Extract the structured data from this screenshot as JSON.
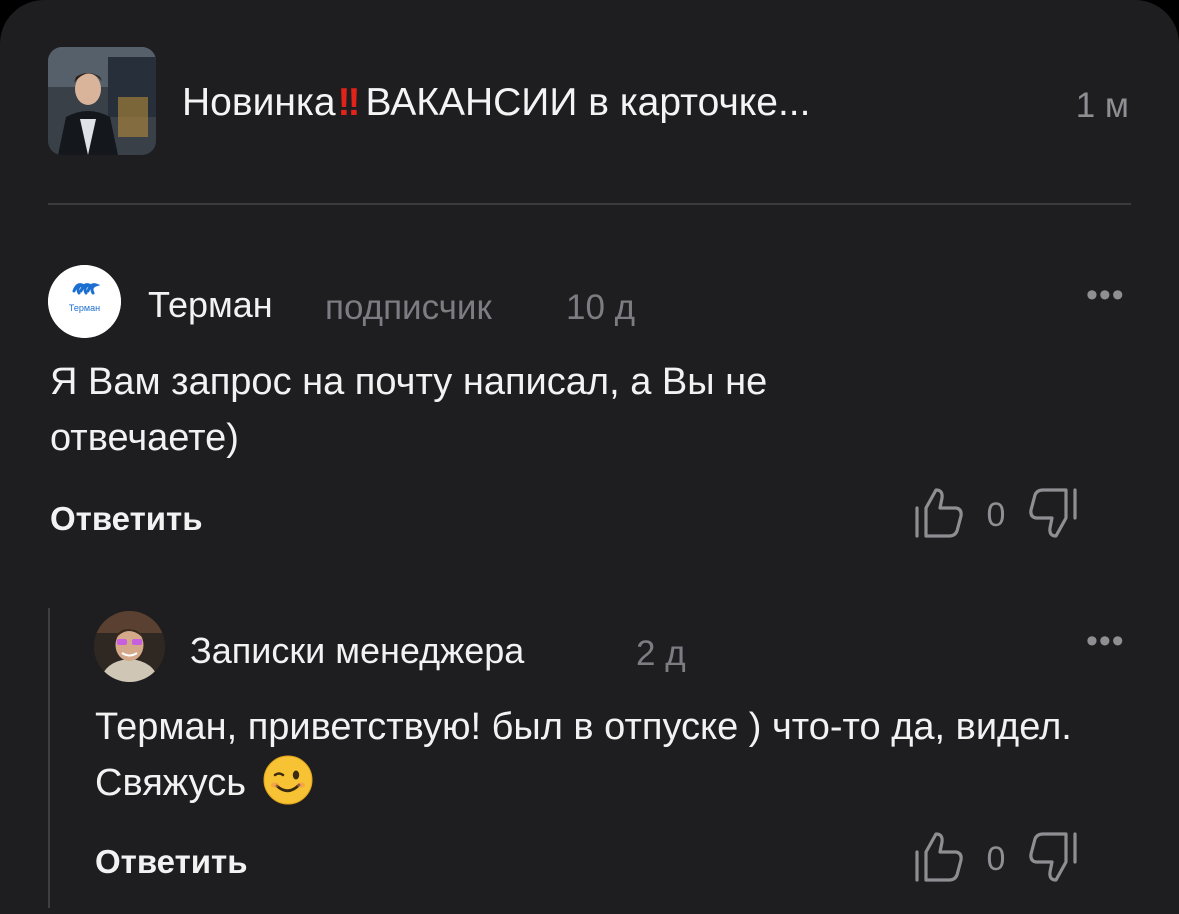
{
  "post": {
    "title_start": "Новинка",
    "title_bang": "!!",
    "title_end": "ВАКАНСИИ в карточке...",
    "age": "1 м",
    "thumbnail_icon": "author-photo"
  },
  "comments": [
    {
      "author": "Терман",
      "role": "подписчик",
      "age": "10 д",
      "text": "Я Вам запрос на почту написал, а Вы не отвечаете)",
      "reply_label": "Ответить",
      "likes": "0",
      "avatar_logo_text": "Терман",
      "menu_icon": "more-dots-icon"
    },
    {
      "author": "Записки менеджера",
      "age": "2 д",
      "text": "Терман, приветствую! был в отпуске ) что-то да, видел. Свяжусь",
      "emoji": "winking-face",
      "reply_label": "Ответить",
      "likes": "0",
      "menu_icon": "more-dots-icon"
    }
  ],
  "colors": {
    "background": "#1e1e20",
    "text": "#f2f2f2",
    "muted": "#7c7c82",
    "accent_red": "#e2231a",
    "logo_blue": "#1c6fd1"
  }
}
